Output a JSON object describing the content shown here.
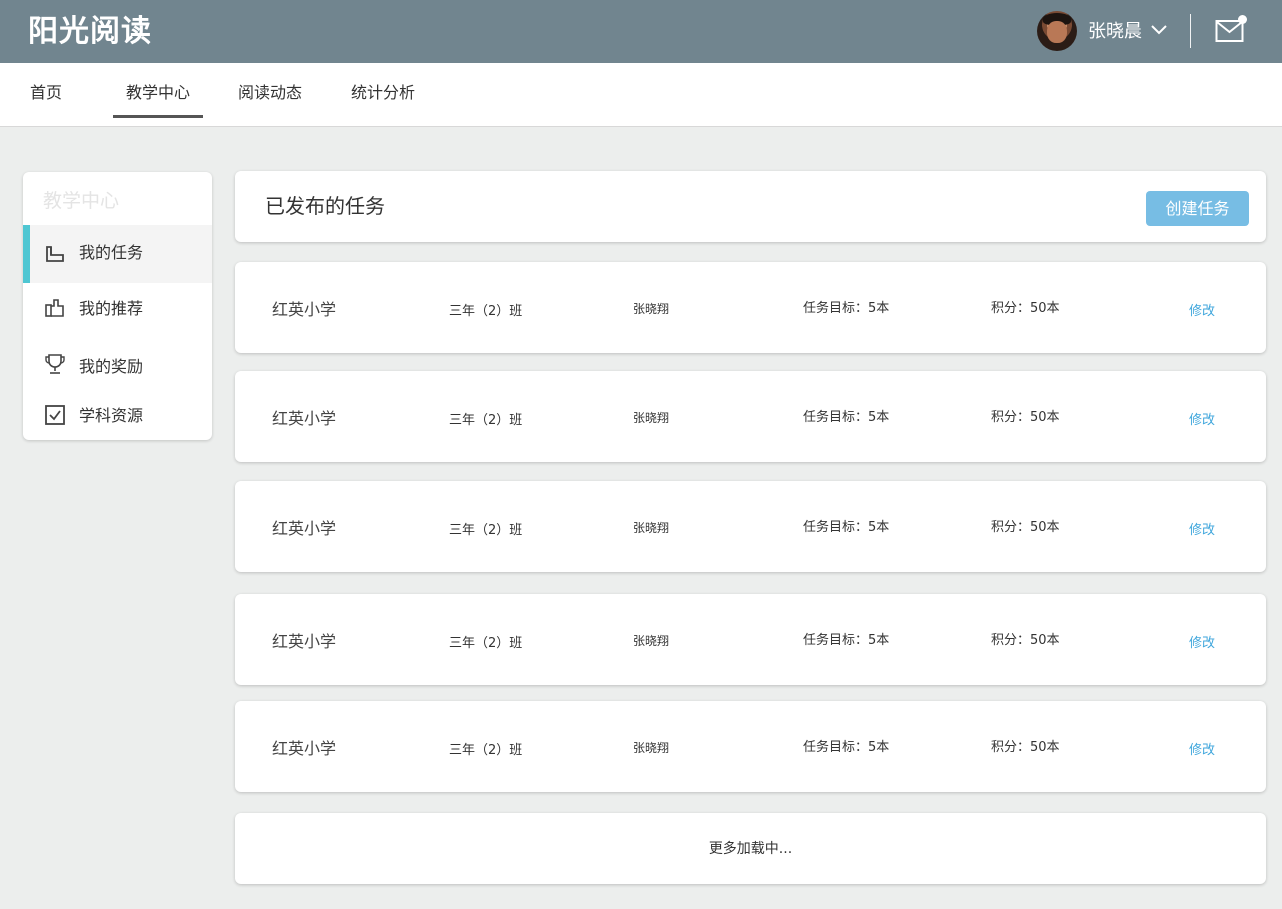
{
  "app": {
    "logo": "阳光阅读"
  },
  "user": {
    "name": "张晓晨"
  },
  "nav": {
    "items": [
      {
        "label": "首页"
      },
      {
        "label": "教学中心"
      },
      {
        "label": "阅读动态"
      },
      {
        "label": "统计分析"
      }
    ],
    "active_index": 1
  },
  "sidebar": {
    "title": "教学中心",
    "items": [
      {
        "label": "我的任务",
        "icon": "tray-icon"
      },
      {
        "label": "我的推荐",
        "icon": "thumbs-up-icon"
      },
      {
        "label": "我的奖励",
        "icon": "trophy-icon"
      },
      {
        "label": "学科资源",
        "icon": "checkbox-icon"
      }
    ],
    "active_index": 0
  },
  "main": {
    "title": "已发布的任务",
    "create_button": "创建任务",
    "tasks": [
      {
        "school": "红英小学",
        "class": "三年（2）班",
        "teacher": "张晓翔",
        "target": "任务目标：5本",
        "points": "积分：50本",
        "action": "修改"
      },
      {
        "school": "红英小学",
        "class": "三年（2）班",
        "teacher": "张晓翔",
        "target": "任务目标：5本",
        "points": "积分：50本",
        "action": "修改"
      },
      {
        "school": "红英小学",
        "class": "三年（2）班",
        "teacher": "张晓翔",
        "target": "任务目标：5本",
        "points": "积分：50本",
        "action": "修改"
      },
      {
        "school": "红英小学",
        "class": "三年（2）班",
        "teacher": "张晓翔",
        "target": "任务目标：5本",
        "points": "积分：50本",
        "action": "修改"
      },
      {
        "school": "红英小学",
        "class": "三年（2）班",
        "teacher": "张晓翔",
        "target": "任务目标：5本",
        "points": "积分：50本",
        "action": "修改"
      }
    ],
    "loading_more": "更多加载中..."
  },
  "colors": {
    "topbar": "#71858f",
    "accent": "#4ec6d2",
    "button": "#77bde4",
    "link": "#3fa6dc"
  }
}
